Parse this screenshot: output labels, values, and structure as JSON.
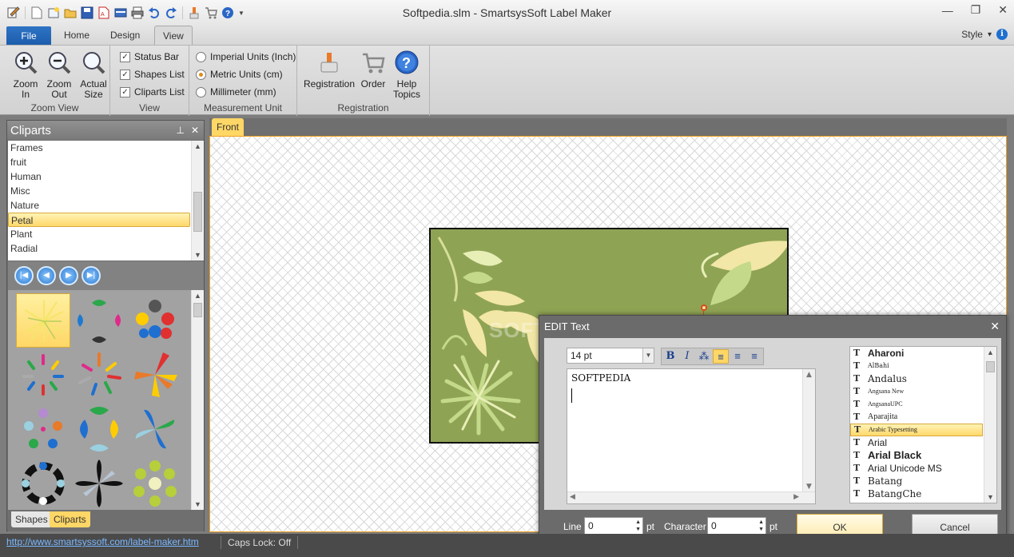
{
  "window": {
    "title": "Softpedia.slm - SmartsysSoft Label Maker",
    "minimize_icon": "minimize-icon",
    "restore_icon": "restore-icon",
    "close_icon": "close-icon"
  },
  "quick_access": [
    "new-document-icon",
    "new-label-icon",
    "open-folder-icon",
    "save-icon",
    "export-pdf-icon",
    "card-icon",
    "print-icon",
    "undo-icon",
    "redo-icon",
    "brush-icon",
    "cart-icon",
    "help-icon",
    "dropdown-arrow-icon"
  ],
  "ribbon_tabs": [
    {
      "label": "File"
    },
    {
      "label": "Home"
    },
    {
      "label": "Design"
    },
    {
      "label": "View",
      "active": true
    }
  ],
  "style": {
    "label": "Style",
    "arrow": "▾",
    "info": "i"
  },
  "ribbon": {
    "zoom_view": {
      "title": "Zoom View",
      "zoom_in": "Zoom\nIn",
      "zoom_out": "Zoom\nOut",
      "actual_size": "Actual\nSize"
    },
    "view": {
      "title": "View",
      "status_bar": {
        "label": "Status Bar",
        "checked": true
      },
      "shapes_list": {
        "label": "Shapes List",
        "checked": true
      },
      "cliparts_list": {
        "label": "Cliparts List",
        "checked": true
      }
    },
    "measurement": {
      "title": "Measurement Unit",
      "imperial": {
        "label": "Imperial Units (Inch)",
        "selected": false
      },
      "metric": {
        "label": "Metric Units (cm)",
        "selected": true
      },
      "mm": {
        "label": "Millimeter (mm)",
        "selected": false
      }
    },
    "registration": {
      "title": "Registration",
      "registration": "Registration",
      "order": "Order",
      "help": "Help\nTopics"
    }
  },
  "cliparts_panel": {
    "title": "Cliparts",
    "pin": "📌",
    "close": "✕",
    "categories": [
      {
        "label": "Frames"
      },
      {
        "label": "fruit"
      },
      {
        "label": "Human"
      },
      {
        "label": "Misc"
      },
      {
        "label": "Nature"
      },
      {
        "label": "Petal",
        "selected": true
      },
      {
        "label": "Plant"
      },
      {
        "label": "Radial"
      }
    ],
    "tabs": [
      {
        "label": "Shapes"
      },
      {
        "label": "Cliparts",
        "active": true
      }
    ]
  },
  "document": {
    "tab": "Front"
  },
  "edit_text_dialog": {
    "title": "EDIT Text",
    "size": "14 pt",
    "text": "SOFTPEDIA",
    "fonts": [
      {
        "name": "Aharoni",
        "weight": "bold"
      },
      {
        "name": "AlBahi"
      },
      {
        "name": "Andalus"
      },
      {
        "name": "Angsana New"
      },
      {
        "name": "AngsanaUPC"
      },
      {
        "name": "Aparajita"
      },
      {
        "name": "Arabic Typesetting",
        "selected": true
      },
      {
        "name": "Arial"
      },
      {
        "name": "Arial Black",
        "weight": "bold"
      },
      {
        "name": "Arial Unicode MS"
      },
      {
        "name": "Batang"
      },
      {
        "name": "BatangChe"
      }
    ],
    "line_label": "Line",
    "line_value": "0",
    "line_unit": "pt",
    "character_label": "Character",
    "character_value": "0",
    "character_unit": "pt",
    "ok": "OK",
    "cancel": "Cancel"
  },
  "watermark": "SOFTPEDIA",
  "status_bar": {
    "link": "http://www.smartsyssoft.com/label-maker.htm",
    "caps_lock": "Caps Lock: Off"
  },
  "colors": {
    "accent": "#1f6fd0",
    "highlight": "#ffd766",
    "label_bg": "#8fa354"
  }
}
